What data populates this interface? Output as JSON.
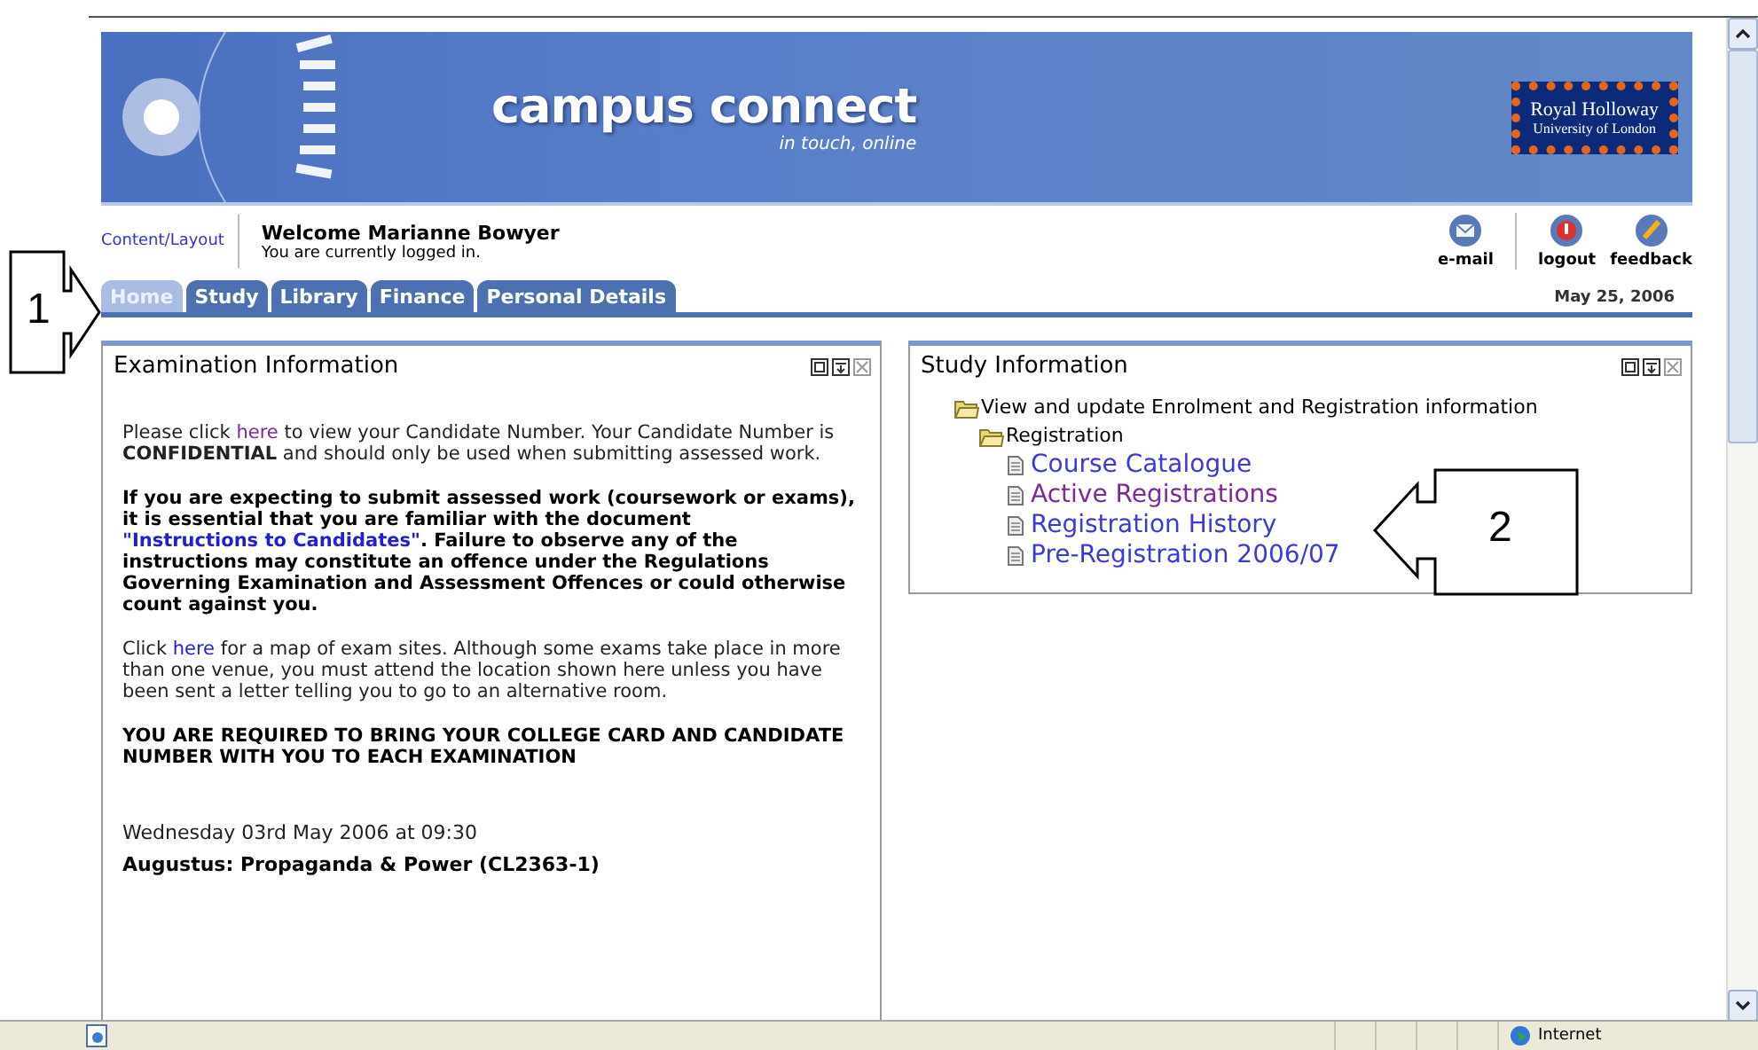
{
  "banner": {
    "title": "campus connect",
    "tagline": "in touch, online",
    "logo_line1": "Royal Holloway",
    "logo_line2": "University of London"
  },
  "header": {
    "content_link": "Content/Layout",
    "welcome": "Welcome Marianne Bowyer",
    "status": "You are currently logged in.",
    "actions": [
      {
        "label": "e-mail",
        "kind": "email"
      },
      {
        "label": "logout",
        "kind": "logout"
      },
      {
        "label": "feedback",
        "kind": "feedback"
      }
    ]
  },
  "tabs": [
    {
      "label": "Home",
      "selected": true
    },
    {
      "label": "Study",
      "selected": false
    },
    {
      "label": "Library",
      "selected": false
    },
    {
      "label": "Finance",
      "selected": false
    },
    {
      "label": "Personal Details",
      "selected": false
    }
  ],
  "date": "May 25, 2006",
  "exam_panel": {
    "title": "Examination Information",
    "paragraphs": [
      {
        "bold": false,
        "parts": [
          {
            "kind": "text",
            "text": "Please click "
          },
          {
            "kind": "link",
            "text": "here",
            "visited": true
          },
          {
            "kind": "text",
            "text": " to view your Candidate Number. Your Candidate Number is **CONFIDENTIAL** and should only be used when submitting assessed work."
          }
        ]
      },
      {
        "bold": true,
        "parts": [
          {
            "kind": "text",
            "text": "If you are expecting to submit assessed work (coursework or exams), it is essential that you are familiar with the document "
          },
          {
            "kind": "link",
            "text": "\"Instructions to Candidates\"",
            "visited": false
          },
          {
            "kind": "text",
            "text": ". Failure to observe any of the instructions may constitute an offence under the Regulations Governing Examination and Assessment Offences or could otherwise count against you."
          }
        ]
      },
      {
        "bold": false,
        "parts": [
          {
            "kind": "text",
            "text": "Click "
          },
          {
            "kind": "link",
            "text": "here",
            "visited": false
          },
          {
            "kind": "text",
            "text": " for a map of exam sites. Although some exams take place in more than one venue, you must attend the location shown here unless you have been sent a letter telling you to go to an alternative room."
          }
        ]
      },
      {
        "bold": true,
        "parts": [
          {
            "kind": "text",
            "text": "YOU ARE REQUIRED TO BRING YOUR COLLEGE CARD AND CANDIDATE NUMBER WITH YOU TO EACH EXAMINATION"
          }
        ]
      }
    ],
    "exam_date": "Wednesday 03rd May 2006 at 09:30",
    "exam_name": "Augustus: Propaganda & Power (CL2363-1)"
  },
  "study_panel": {
    "title": "Study Information",
    "tree": [
      {
        "label": "View and update Enrolment and Registration information",
        "kind": "folder",
        "children": [
          {
            "label": "Registration",
            "kind": "folder",
            "children": [
              {
                "label": "Course Catalogue",
                "kind": "page",
                "visited": false
              },
              {
                "label": "Active Registrations",
                "kind": "page",
                "visited": true
              },
              {
                "label": "Registration History",
                "kind": "page",
                "visited": false
              },
              {
                "label": "Pre-Registration 2006/07",
                "kind": "page",
                "visited": false
              }
            ]
          }
        ]
      }
    ]
  },
  "callouts": [
    {
      "number": "1",
      "kind": "right"
    },
    {
      "number": "2",
      "kind": "left"
    }
  ],
  "status_bar": {
    "zone": "Internet"
  }
}
